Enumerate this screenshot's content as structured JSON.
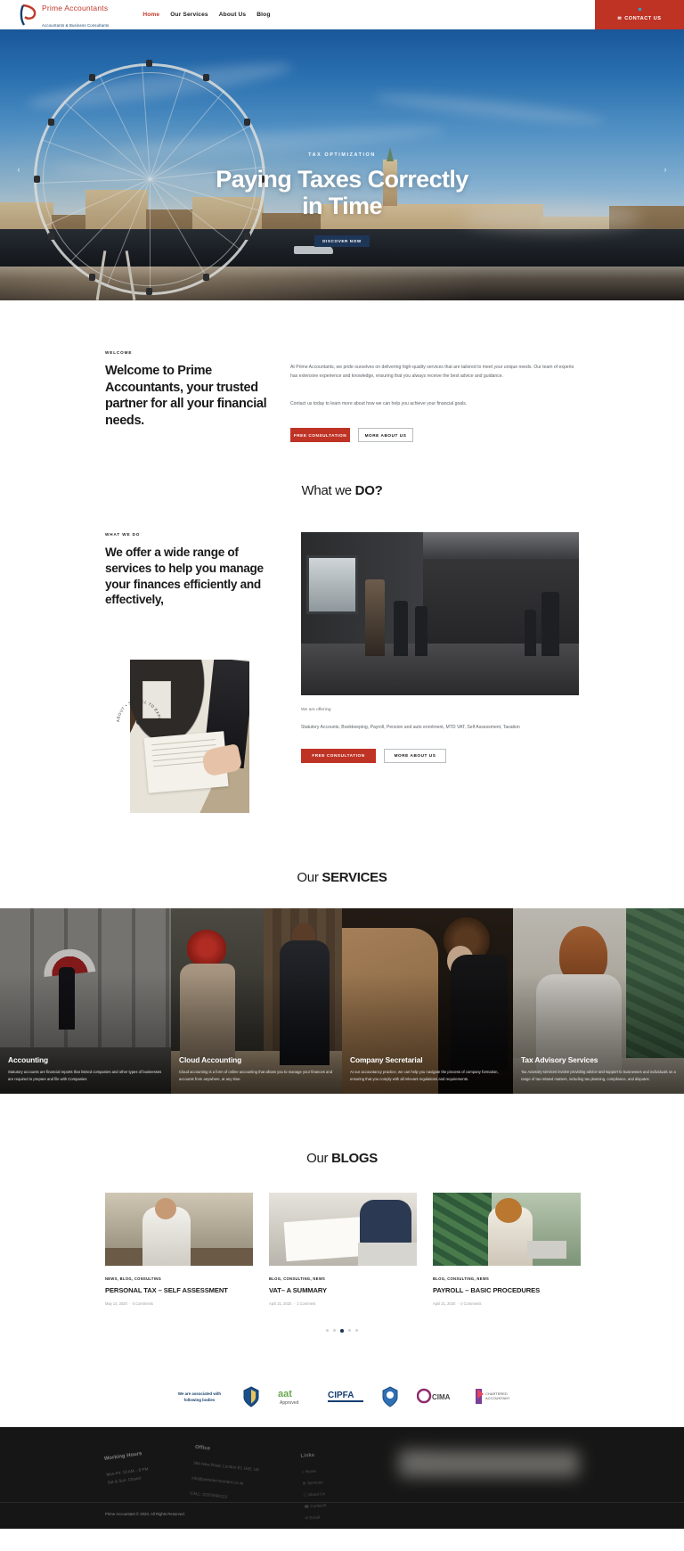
{
  "header": {
    "logo": {
      "title": "Prime Accountants",
      "subtitle": "Accountants & Business Consultants",
      "icon": "prime-logo-icon"
    },
    "nav": [
      {
        "label": "Home",
        "active": true
      },
      {
        "label": "Our Services",
        "active": false
      },
      {
        "label": "About Us",
        "active": false
      },
      {
        "label": "Blog",
        "active": false
      }
    ],
    "contact_button": {
      "label": "CONTACT US",
      "icon": "envelope-icon",
      "bg": "#bf3325"
    }
  },
  "hero": {
    "eyebrow": "TAX OPTIMIZATION",
    "title_line1": "Paying Taxes Correctly",
    "title_line2": "in Time",
    "button": "DISCOVER NOW",
    "arrow_left": "‹",
    "arrow_right": "›"
  },
  "welcome": {
    "eyebrow": "WELCOME",
    "heading": "Welcome to Prime Accountants, your trusted partner for all your financial needs.",
    "paragraph1": "At Prime Accountants, we pride ourselves on delivering high-quality services that are tailored to meet your unique needs. Our team of experts has extensive experience and knowledge, ensuring that you always receive the best advice and guidance.",
    "paragraph2": "Contact us today to learn more about how we can help you achieve your financial goals.",
    "btn_primary": "FREE CONSULTATION",
    "btn_secondary": "MORE ABOUT US"
  },
  "whatwedo": {
    "section_title_light": "What we ",
    "section_title_bold": "DO?",
    "eyebrow": "WHAT WE DO",
    "heading": "We offer a wide range of services to help you manage your finances efficiently and effectively,",
    "badge_text": "ABOUT • SCROLL TO EXPLORE •",
    "offering_label": "We are offering:",
    "offering_text": "Statutory Accounts, Bookkeeping, Payroll, Pension and auto enrolment, MTD VAT, Self Assessment, Taxation",
    "btn_primary": "FREE CONSULTATION",
    "btn_secondary": "MORE ABOUT US"
  },
  "services": {
    "section_title_light": "Our ",
    "section_title_bold": "SERVICES",
    "cards": [
      {
        "title": "Accounting",
        "desc": "Statutory accounts are financial reports that limited companies and other types of businesses are required to prepare and file with Companies"
      },
      {
        "title": "Cloud Accounting",
        "desc": "Cloud accounting is a form of online accounting that allows you to manage your finances and accounts from anywhere, at any time."
      },
      {
        "title": "Company Secretarial",
        "desc": "At our accountancy practice, we can help you navigate the process of company formation, ensuring that you comply with all relevant regulations and requirements."
      },
      {
        "title": "Tax Advisory Services",
        "desc": "Tax Advisory services involve providing advice and support to businesses and individuals on a range of tax-related matters, including tax planning, compliance, and disputes."
      }
    ]
  },
  "blogs": {
    "section_title_light": "Our ",
    "section_title_bold": "BLOGS",
    "posts": [
      {
        "categories": "NEWS, BLOG, CONSULTING",
        "title": "PERSONAL TAX – SELF ASSESSMENT",
        "date": "May 14, 2020",
        "comments": "0 Comments"
      },
      {
        "categories": "BLOG, CONSULTING, NEWS",
        "title": "VAT– A SUMMARY",
        "date": "April 21, 2020",
        "comments": "1 Comment"
      },
      {
        "categories": "BLOG, CONSULTING, NEWS",
        "title": "PAYROLL – BASIC PROCEDURES",
        "date": "April 21, 2020",
        "comments": "0 Comments"
      }
    ],
    "carousel_dots": 5,
    "active_dot": 2
  },
  "partners": {
    "assoc_text": "We are associated with following bodies",
    "logos": [
      "icaew-crest",
      "aat-approved",
      "cipfa",
      "acca-crest",
      "cima",
      "chartered-accountants"
    ]
  },
  "footer": {
    "working_hours": {
      "title": "Working Hours",
      "line1": "Mon-Fri: 10 AM – 6 PM",
      "line2": "Sat & Sun: Closed"
    },
    "office": {
      "title": "Office",
      "address": "39A New Road, London E1 1HE, UK",
      "email": "info@primeaccountant.co.uk",
      "phone": "CALL: 02070690113"
    },
    "links": {
      "title": "Links",
      "items": [
        {
          "label": "Home",
          "icon": "home-icon"
        },
        {
          "label": "Services",
          "icon": "gear-icon"
        },
        {
          "label": "About Us",
          "icon": "info-icon"
        },
        {
          "label": "Contacts",
          "icon": "phone-icon"
        },
        {
          "label": "Email",
          "icon": "envelope-icon"
        }
      ]
    },
    "social": {
      "title": "Get In Touch",
      "icons": [
        "facebook-icon",
        "twitter-icon",
        "pinterest-icon",
        "instagram-icon"
      ]
    },
    "copyright": "Prime Accountant © 2023. All Rights Reserved."
  }
}
